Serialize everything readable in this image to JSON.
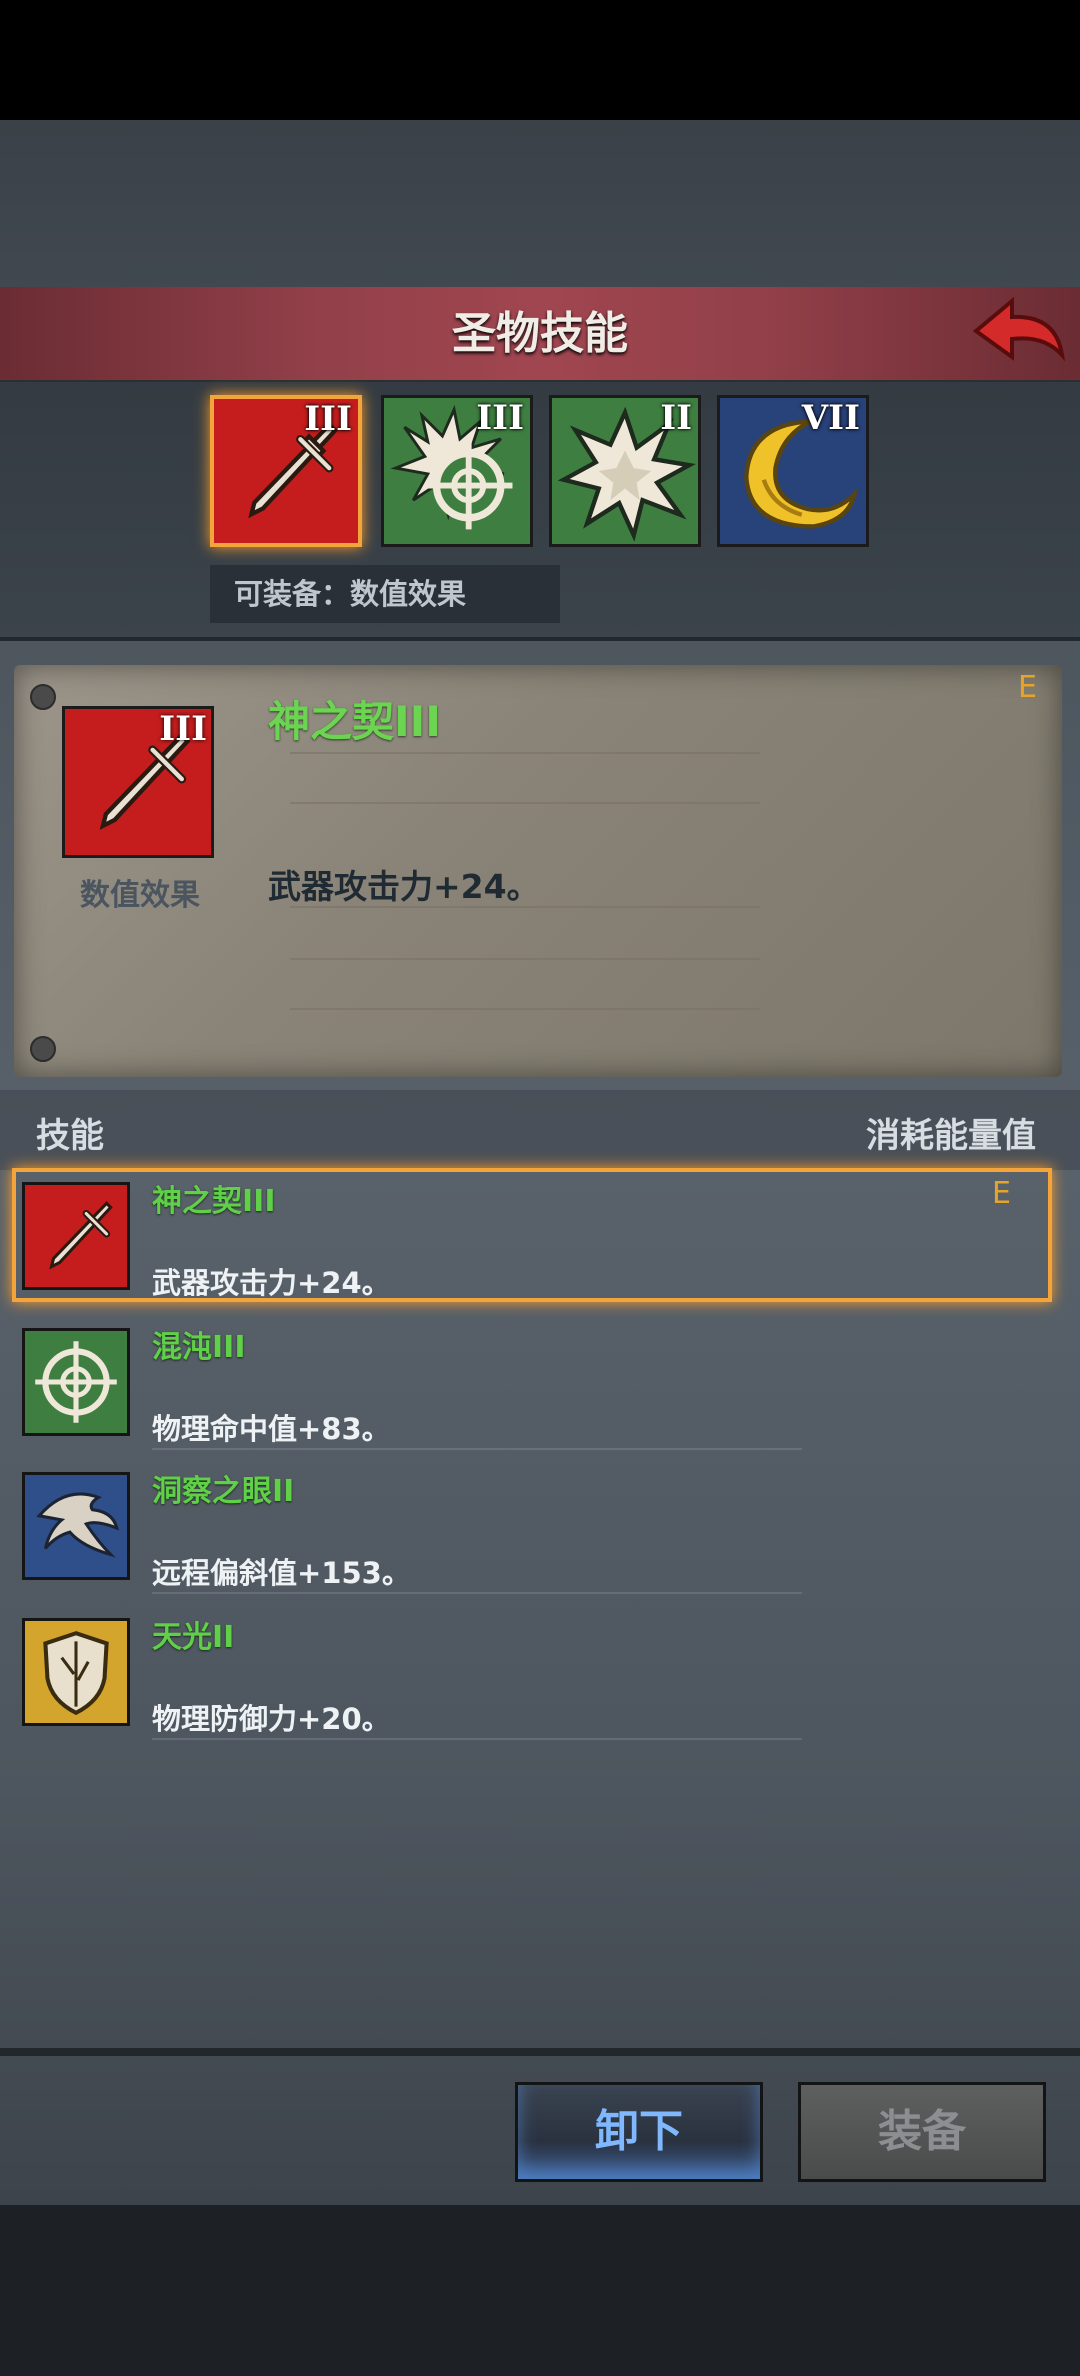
{
  "header": {
    "title": "圣物技能"
  },
  "top_slots": [
    {
      "level": "III",
      "icon": "sword-icon",
      "color": "red",
      "selected": true
    },
    {
      "level": "III",
      "icon": "crosshair-burst-icon",
      "color": "green",
      "selected": false
    },
    {
      "level": "II",
      "icon": "burst-icon",
      "color": "green",
      "selected": false
    },
    {
      "level": "VII",
      "icon": "crescent-moon-icon",
      "color": "blue",
      "selected": false
    }
  ],
  "equip_hint": "可装备：数值效果",
  "detail": {
    "level": "III",
    "type_label": "数值效果",
    "name": "神之契III",
    "effect": "武器攻击力+24。",
    "equipped_mark": "E"
  },
  "list_header": {
    "left": "技能",
    "right": "消耗能量值"
  },
  "skills": [
    {
      "name": "神之契III",
      "effect": "武器攻击力+24。",
      "icon": "sword-icon",
      "equipped_mark": "E"
    },
    {
      "name": "混沌III",
      "effect": "物理命中值+83。",
      "icon": "crosshair-icon"
    },
    {
      "name": "洞察之眼II",
      "effect": "远程偏斜值+153。",
      "icon": "hawk-icon"
    },
    {
      "name": "天光II",
      "effect": "物理防御力+20。",
      "icon": "shield-icon"
    }
  ],
  "buttons": {
    "unequip": "卸下",
    "equip": "装备"
  },
  "colors": {
    "accent_orange": "#f3a53c",
    "skill_green": "#5fd048",
    "header_red": "#93404a"
  }
}
